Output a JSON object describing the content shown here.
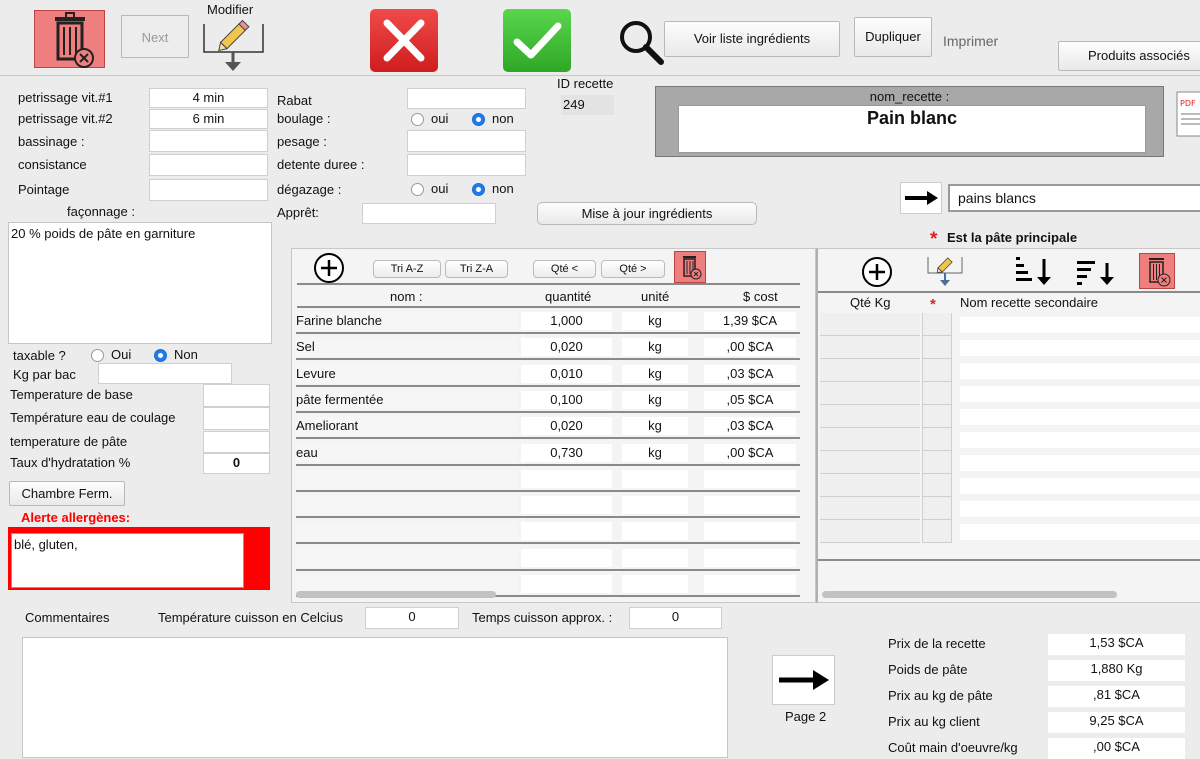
{
  "toolbar": {
    "next_label": "Next",
    "modifier_label": "Modifier",
    "voir_liste_label": "Voir liste ingrédients",
    "dupliquer_label": "Dupliquer",
    "imprimer_label": "Imprimer",
    "produits_label": "Produits associés"
  },
  "id_recette": {
    "label": "ID recette",
    "value": "249"
  },
  "nom_recette": {
    "label": "nom_recette :",
    "value": "Pain blanc"
  },
  "category_value": "pains blancs",
  "params_left": [
    {
      "label": "petrissage vit.#1",
      "value": "4 min"
    },
    {
      "label": "petrissage vit.#2",
      "value": "6 min"
    },
    {
      "label": "bassinage :",
      "value": ""
    },
    {
      "label": "consistance",
      "value": ""
    },
    {
      "label": "Pointage",
      "value": ""
    }
  ],
  "params_mid": {
    "rabat": "Rabat",
    "boulage": "boulage :",
    "pesage": "pesage :",
    "detente": "detente duree :",
    "degazage": "dégazage :",
    "appret": "Apprêt:",
    "oui": "oui",
    "non": "non"
  },
  "mise_a_jour_label": "Mise à jour ingrédients",
  "faconnage": {
    "label": "façonnage :",
    "value": "20 % poids de pâte en garniture"
  },
  "taxable": {
    "label": "taxable ?",
    "oui": "Oui",
    "non": "Non"
  },
  "kg_par_bac": {
    "label": "Kg par bac",
    "value": ""
  },
  "temps": [
    {
      "label": "Temperature de base",
      "value": ""
    },
    {
      "label": "Température eau de coulage",
      "value": ""
    },
    {
      "label": "temperature de pâte",
      "value": ""
    },
    {
      "label": "Taux d'hydratation %",
      "value": "0"
    }
  ],
  "chambre_label": "Chambre Ferm.",
  "allergenes": {
    "label": "Alerte allergènes:",
    "value": "blé, gluten,"
  },
  "ingredients": {
    "sort_buttons": [
      "Tri A-Z",
      "Tri Z-A",
      "Qté  <",
      "Qté  >"
    ],
    "headers": [
      "nom :",
      "quantité",
      "unité",
      "$ cost"
    ],
    "rows": [
      {
        "nom": "Farine blanche",
        "qte": "1,000",
        "unite": "kg",
        "cost": "1,39 $CA"
      },
      {
        "nom": "Sel",
        "qte": "0,020",
        "unite": "kg",
        "cost": ",00 $CA"
      },
      {
        "nom": "Levure",
        "qte": "0,010",
        "unite": "kg",
        "cost": ",03 $CA"
      },
      {
        "nom": "pâte fermentée",
        "qte": "0,100",
        "unite": "kg",
        "cost": ",05 $CA"
      },
      {
        "nom": "Ameliorant",
        "qte": "0,020",
        "unite": "kg",
        "cost": ",03 $CA"
      },
      {
        "nom": "eau",
        "qte": "0,730",
        "unite": "kg",
        "cost": ",00 $CA"
      }
    ]
  },
  "secondary": {
    "title": "Est la pâte principale",
    "star": "*",
    "headers": [
      "Qté Kg",
      "*",
      "Nom recette secondaire"
    ]
  },
  "commentaires_label": "Commentaires",
  "cuisson": {
    "temp_label": "Température cuisson en Celcius",
    "temp_value": "0",
    "temps_label": "Temps cuisson approx. :",
    "temps_value": "0"
  },
  "page2_label": "Page 2",
  "totals": [
    {
      "label": "Prix de la recette",
      "value": "1,53 $CA"
    },
    {
      "label": "Poids de pâte",
      "value": "1,880 Kg"
    },
    {
      "label": "Prix au kg de pâte",
      "value": ",81 $CA"
    },
    {
      "label": "Prix au kg client",
      "value": "9,25 $CA"
    },
    {
      "label": "Coût main d'oeuvre/kg",
      "value": ",00 $CA"
    }
  ],
  "colors": {
    "danger": "#ee2b2b",
    "confirm": "#35b82c",
    "alert": "#ff0000",
    "selected": "#1e7cf0"
  }
}
